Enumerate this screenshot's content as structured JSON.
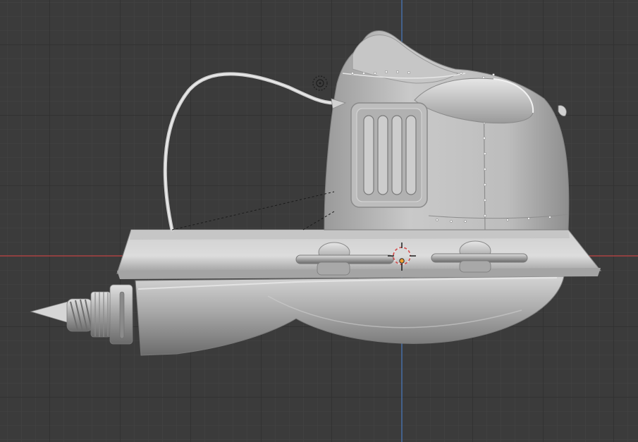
{
  "viewport": {
    "mode": "3d-viewport-orthographic-side",
    "background_color": "#3b3b3b",
    "grid_minor_color": "#454545",
    "grid_major_color": "#2f2f2f",
    "x_axis_color": "#c24545",
    "z_axis_color": "#4a78b8"
  },
  "model": {
    "name_icon": "hover-vehicle-mesh",
    "material_color": "#b9b9b9",
    "shade_dark": "#6f6f6f",
    "shade_light": "#e2e2e2"
  },
  "widgets": {
    "cursor_icon": "3d-cursor-icon",
    "light_icon": "light-object-icon",
    "origin_icon": "object-origin-icon"
  }
}
